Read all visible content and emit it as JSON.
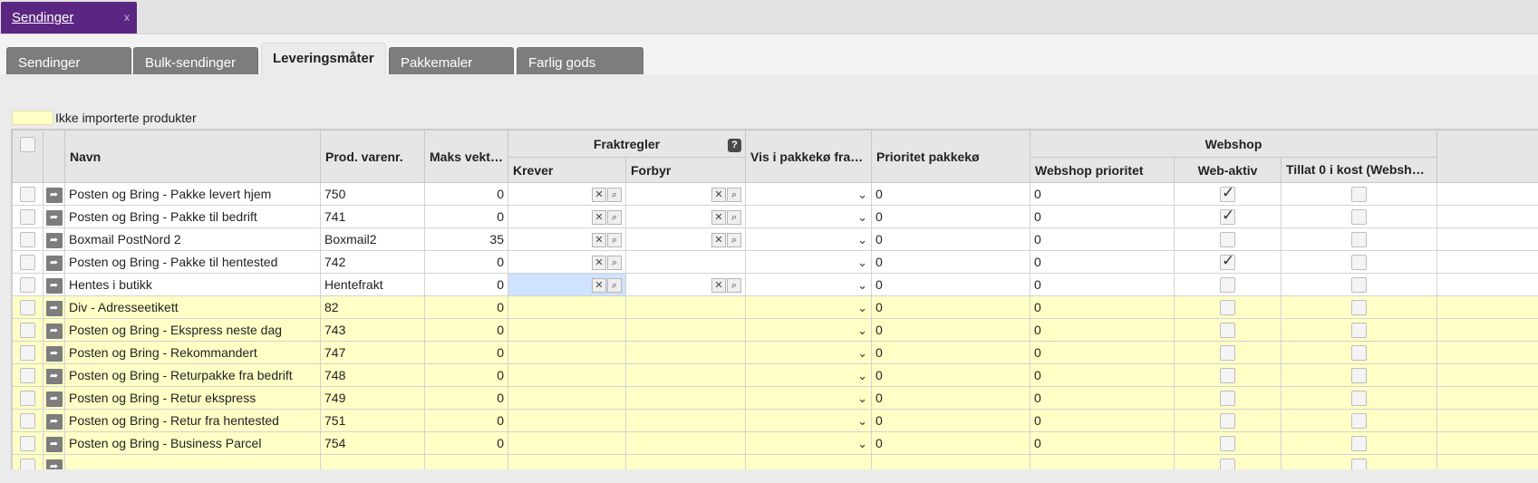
{
  "window_tab": {
    "label": "Sendinger",
    "close": "x"
  },
  "subtabs": [
    {
      "label": "Sendinger",
      "active": false
    },
    {
      "label": "Bulk-sendinger",
      "active": false
    },
    {
      "label": "Leveringsmåter",
      "active": true
    },
    {
      "label": "Pakkemaler",
      "active": false
    },
    {
      "label": "Farlig gods",
      "active": false
    }
  ],
  "legend": {
    "text": "Ikke importerte produkter",
    "color": "#ffffc6"
  },
  "columns": {
    "navn": "Navn",
    "prod_varenr": "Prod. varenr.",
    "maks_vekt": "Maks vekt (…",
    "fraktregler": "Fraktregler",
    "krever": "Krever",
    "forbyr": "Forbyr",
    "vis_i_pakkeko": "Vis i pakkekø fra kl.",
    "prioritet_pakkeko": "Prioritet pakkekø",
    "webshop": "Webshop",
    "webshop_prioritet": "Webshop prioritet",
    "web_aktiv": "Web-aktiv",
    "tillat_0": "Tillat 0 i kost (Webshop)"
  },
  "rows": [
    {
      "navn": "Posten og Bring - Pakke levert hjem",
      "varenr": "750",
      "vekt": "0",
      "prio": "0",
      "wprio": "0",
      "web_aktiv": true,
      "tillat": false,
      "imported": true,
      "krever_icons": true,
      "forbyr_icons": true
    },
    {
      "navn": "Posten og Bring - Pakke til bedrift",
      "varenr": "741",
      "vekt": "0",
      "prio": "0",
      "wprio": "0",
      "web_aktiv": true,
      "tillat": false,
      "imported": true,
      "krever_icons": true,
      "forbyr_icons": true
    },
    {
      "navn": "Boxmail PostNord 2",
      "varenr": "Boxmail2",
      "vekt": "35",
      "prio": "0",
      "wprio": "0",
      "web_aktiv": false,
      "tillat": false,
      "imported": true,
      "krever_icons": true,
      "forbyr_icons": true
    },
    {
      "navn": "Posten og Bring - Pakke til hentested",
      "varenr": "742",
      "vekt": "0",
      "prio": "0",
      "wprio": "0",
      "web_aktiv": true,
      "tillat": false,
      "imported": true,
      "krever_icons": true,
      "forbyr_icons": false
    },
    {
      "navn": "Hentes i butikk",
      "varenr": "Hentefrakt",
      "vekt": "0",
      "prio": "0",
      "wprio": "0",
      "web_aktiv": false,
      "tillat": false,
      "imported": true,
      "krever_icons": true,
      "forbyr_icons": true,
      "selected_krever": true
    },
    {
      "navn": "Div - Adresseetikett",
      "varenr": "82",
      "vekt": "0",
      "prio": "0",
      "wprio": "0",
      "web_aktiv": false,
      "tillat": false,
      "imported": false
    },
    {
      "navn": "Posten og Bring - Ekspress neste dag",
      "varenr": "743",
      "vekt": "0",
      "prio": "0",
      "wprio": "0",
      "web_aktiv": false,
      "tillat": false,
      "imported": false
    },
    {
      "navn": "Posten og Bring - Rekommandert",
      "varenr": "747",
      "vekt": "0",
      "prio": "0",
      "wprio": "0",
      "web_aktiv": false,
      "tillat": false,
      "imported": false
    },
    {
      "navn": "Posten og Bring - Returpakke fra bedrift",
      "varenr": "748",
      "vekt": "0",
      "prio": "0",
      "wprio": "0",
      "web_aktiv": false,
      "tillat": false,
      "imported": false
    },
    {
      "navn": "Posten og Bring - Retur ekspress",
      "varenr": "749",
      "vekt": "0",
      "prio": "0",
      "wprio": "0",
      "web_aktiv": false,
      "tillat": false,
      "imported": false
    },
    {
      "navn": "Posten og Bring - Retur fra hentested",
      "varenr": "751",
      "vekt": "0",
      "prio": "0",
      "wprio": "0",
      "web_aktiv": false,
      "tillat": false,
      "imported": false
    },
    {
      "navn": "Posten og Bring - Business Parcel",
      "varenr": "754",
      "vekt": "0",
      "prio": "0",
      "wprio": "0",
      "web_aktiv": false,
      "tillat": false,
      "imported": false
    },
    {
      "navn": "",
      "varenr": "",
      "vekt": "",
      "prio": "",
      "wprio": "",
      "web_aktiv": false,
      "tillat": false,
      "imported": false
    }
  ]
}
